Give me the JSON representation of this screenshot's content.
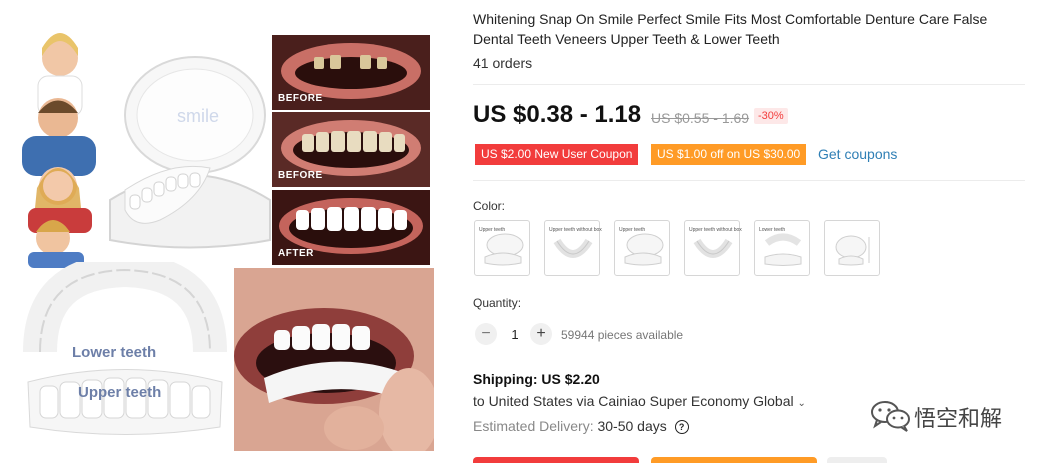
{
  "gallery": {
    "labels": {
      "before1": "BEFORE",
      "before2": "BEFORE",
      "after": "AFTER"
    },
    "lower_teeth": "Lower teeth",
    "upper_teeth": "Upper teeth"
  },
  "product": {
    "title": "Whitening Snap On Smile Perfect Smile Fits Most Comfortable Denture Care False Dental Teeth Veneers Upper Teeth & Lower Teeth",
    "orders": "41 orders",
    "price": "US $0.38 - 1.18",
    "old_price": "US $0.55 - 1.69",
    "discount": "-30%"
  },
  "coupons": {
    "new_user": "US $2.00 New User Coupon",
    "off": "US $1.00 off on US $30.00",
    "get_label": "Get coupons"
  },
  "color": {
    "label": "Color:",
    "swatches": [
      {
        "text": "Upper teeth"
      },
      {
        "text": "Upper teeth without box"
      },
      {
        "text": "Upper teeth"
      },
      {
        "text": "Upper teeth without box"
      },
      {
        "text": "Lower teeth"
      },
      {
        "text": ""
      }
    ]
  },
  "quantity": {
    "label": "Quantity:",
    "minus": "−",
    "value": "1",
    "plus": "+",
    "available": "59944 pieces available"
  },
  "shipping": {
    "title": "Shipping: US $2.20",
    "to": "to United States via Cainiao Super Economy Global",
    "chevron": "⌄",
    "estimated_label": "Estimated Delivery:",
    "estimated_value": "30-50 days",
    "help_icon": "?"
  },
  "watermark": {
    "text": "悟空和解"
  },
  "colors": {
    "price_red": "#f23c3c",
    "coupon_orange": "#ff9b26",
    "link_blue": "#2f7fb5"
  }
}
